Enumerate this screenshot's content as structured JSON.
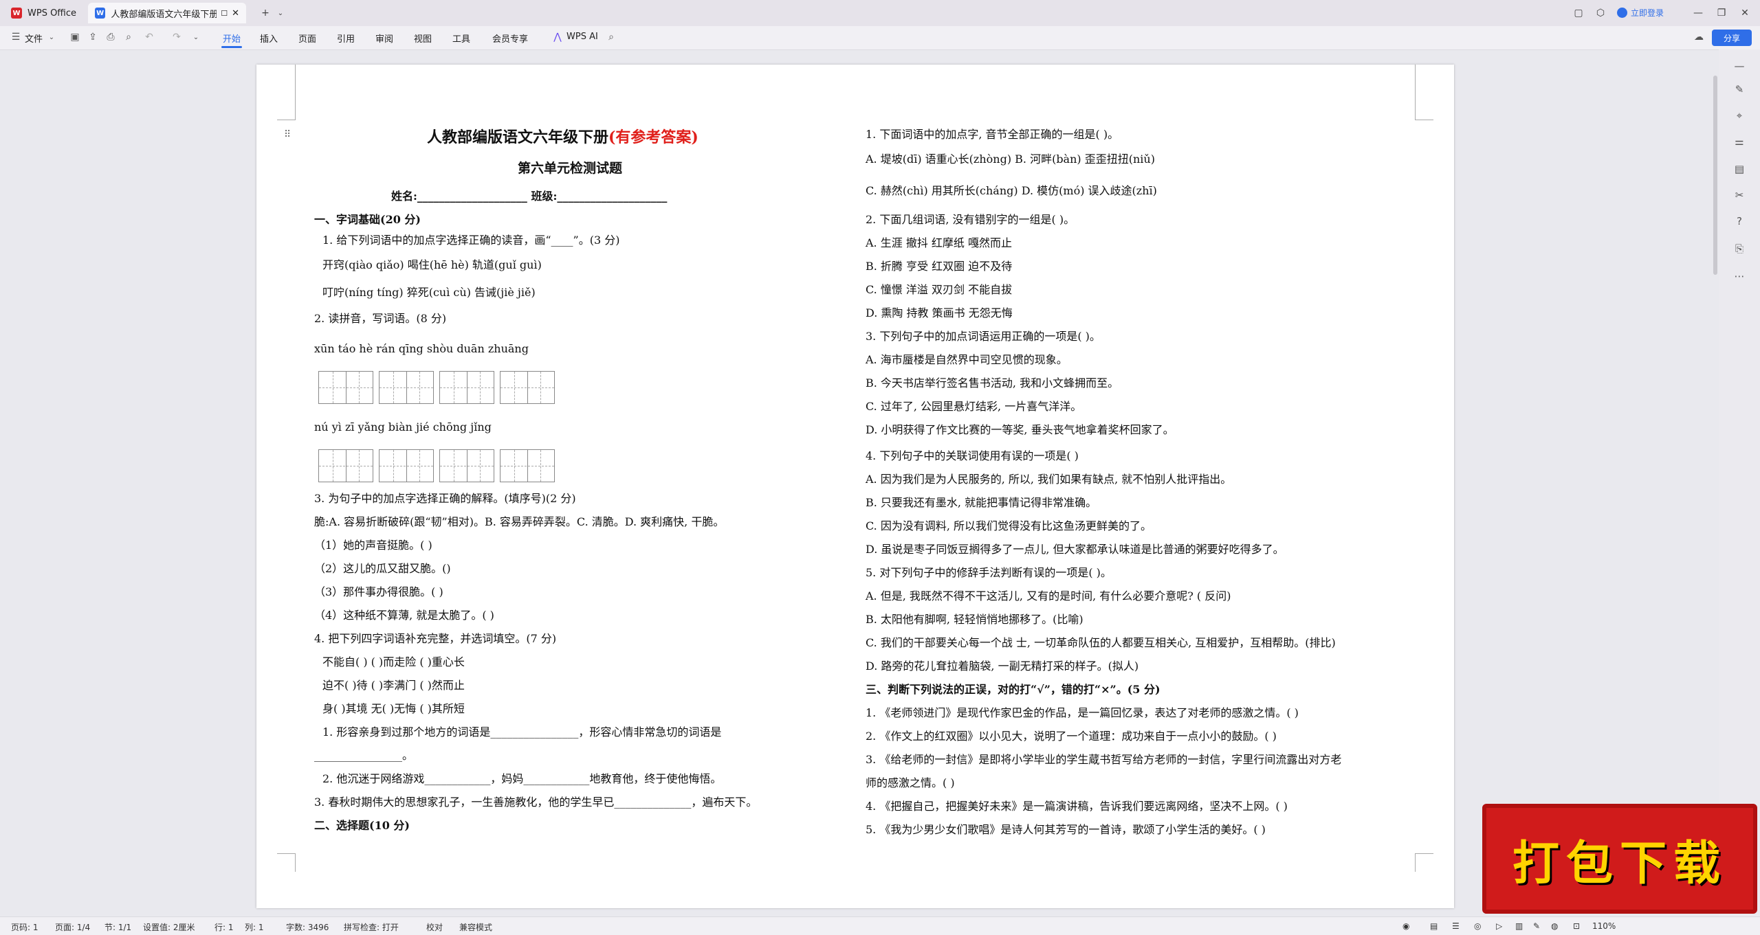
{
  "titlebar": {
    "tabs": [
      {
        "label": "WPS Office"
      },
      {
        "label": "人教部编版语文六年级下册第"
      }
    ],
    "login": "立即登录"
  },
  "ribbon": {
    "file": "文件",
    "tabs": [
      "开始",
      "插入",
      "页面",
      "引用",
      "审阅",
      "视图",
      "工具",
      "会员专享"
    ],
    "wps_ai": "WPS AI",
    "share": "分享"
  },
  "doc": {
    "title_main": "人教部编版语文六年级下册",
    "title_red": "(有参考答案)",
    "subtitle": "第六单元检测试题",
    "name_class": "姓名:____________________  班级:____________________",
    "left": [
      "一、字词基础(20 分)",
      "1. 给下列词语中的加点字选择正确的读音，画“____”。(3 分)",
      "开窍(qiào  qiǎo)          喝住(hē   hè)          轨道(guǐ   guì)",
      "叮咛(níng  tíng)          猝死(cuì   cù)          告诫(jiè   jiě)",
      "2. 读拼音，写词语。(8 分)",
      "xūn  táo              hè  rán             qīng  shòu         duān  zhuāng",
      "nú   yì               zī   yǎng            biàn  jié            chōng  jǐng",
      "3. 为句子中的加点字选择正确的解释。(填序号)(2 分)",
      "脆:A. 容易折断破碎(跟“韧”相对)。B. 容易弄碎弄裂。C. 清脆。D. 爽利痛快, 干脆。",
      "（1）她的声音挺脆。( )",
      "（2）这儿的瓜又甜又脆。()",
      "（3）那件事办得很脆。( )",
      "（4）这种纸不算薄, 就是太脆了。( )",
      "4. 把下列四字词语补充完整，并选词填空。(7 分)",
      "不能自(        )        (        )而走险        (        )重心长",
      "迫不(        )待        (        )李满门        (        )然而止",
      "身(        )其境        无(        )无悔        (        )其所短",
      "1. 形容亲身到过那个地方的词语是________________，形容心情非常急切的词语是",
      "________________。",
      "2. 他沉迷于网络游戏____________，妈妈____________地教育他，终于使他悔悟。",
      "3. 春秋时期伟大的思想家孔子，一生善施教化，他的学生早已______________，遍布天下。",
      "二、选择题(10 分)"
    ],
    "right": [
      "1. 下面词语中的加点字, 音节全部正确的一组是(      )。",
      "A. 堤坡(dī)        语重心长(zhòng) B. 河畔(bàn)      歪歪扭扭(niǔ)",
      "C. 赫然(chì)     用其所长(cháng) D. 模仿(mó)  误入歧途(zhī)",
      "2. 下面几组词语, 没有错别字的一组是(      )。",
      "A. 生涯    撤抖    红摩纸    嘎然而止",
      "B. 折腾    亨受    红双圈    迫不及待",
      "C. 憧憬    洋溢    双刃剑    不能自拔",
      "D. 熏陶    持教    策画书    无怨无悔",
      "3. 下列句子中的加点词语运用正确的一项是( )。",
      "A. 海市蜃楼是自然界中司空见惯的现象。",
      "B. 今天书店举行签名售书活动, 我和小文蜂拥而至。",
      "C. 过年了, 公园里悬灯结彩, 一片喜气洋洋。",
      "D. 小明获得了作文比赛的一等奖, 垂头丧气地拿着奖杯回家了。",
      "4. 下列句子中的关联词使用有误的一项是( )",
      "A. 因为我们是为人民服务的, 所以, 我们如果有缺点, 就不怕别人批评指出。",
      "B. 只要我还有墨水, 就能把事情记得非常准确。",
      "C. 因为没有调料, 所以我们觉得没有比这鱼汤更鲜美的了。",
      "D. 虽说是枣子同饭豆搁得多了一点儿, 但大家都承认味道是比普通的粥要好吃得多了。",
      "5. 对下列句子中的修辞手法判断有误的一项是( )。",
      "A. 但是, 我既然不得不干这活儿, 又有的是时间, 有什么必要介意呢? ( 反问)",
      "B. 太阳他有脚啊, 轻轻悄悄地挪移了。(比喻)",
      "C. 我们的干部要关心每一个战  士, 一切革命队伍的人都要互相关心, 互相爱护，互相帮助。(排比)",
      "D. 路旁的花儿耷拉着脑袋, 一副无精打采的样子。(拟人)",
      "三、判断下列说法的正误，对的打“√”，错的打“×”。(5 分)",
      "1. 《老师领进门》是现代作家巴金的作品，是一篇回忆录，表达了对老师的感激之情。(      )",
      "2. 《作文上的红双圈》以小见大，说明了一个道理：成功来自于一点小小的鼓励。(      )",
      "3. 《给老师的一封信》是即将小学毕业的学生蔵书哲写给方老师的一封信，字里行间流露出对方老",
      "师的感激之情。(      )",
      "4. 《把握自己，把握美好未来》是一篇演讲稿，告诉我们要远离网络，坚决不上网。(      )",
      "5. 《我为少男少女们歌唱》是诗人何其芳写的一首诗，歌颂了小学生活的美好。(      )"
    ]
  },
  "statusbar": {
    "items": [
      "页码: 1",
      "页面: 1/4",
      "节: 1/1",
      "设置值: 2厘米",
      "行: 1",
      "列: 1",
      "字数: 3496",
      "拼写检查: 打开",
      "校对",
      "兼容模式"
    ],
    "zoom": "110%"
  },
  "promo": "打包下载"
}
